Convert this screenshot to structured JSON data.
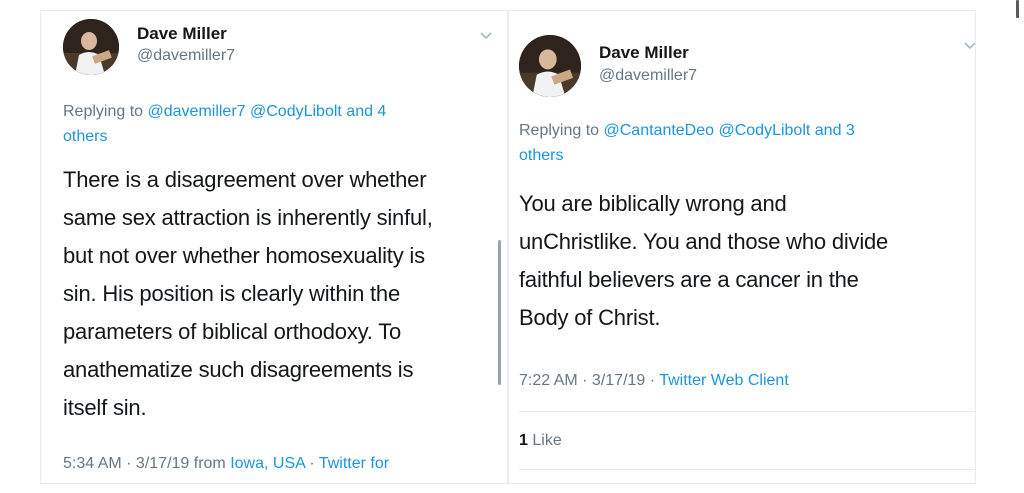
{
  "tweets": [
    {
      "author": {
        "name": "Dave Miller",
        "handle": "@davemiller7"
      },
      "replying": {
        "prefix": "Replying to",
        "links": "@davemiller7 @CodyLibolt and 4",
        "links2": "others"
      },
      "body_lines": [
        "There is a disagreement over whether",
        "same sex attraction is inherently sinful,",
        "but not over whether homosexuality is",
        "sin. His position is clearly within the",
        "parameters of biblical orthodoxy. To",
        "anathematize such disagreements is",
        "itself sin."
      ],
      "meta": {
        "time_date": "5:34 AM · 3/17/19 from",
        "location": "Iowa, USA",
        "sep": "·",
        "client": "Twitter for"
      }
    },
    {
      "author": {
        "name": "Dave Miller",
        "handle": "@davemiller7"
      },
      "replying": {
        "prefix": "Replying to",
        "links": "@CantanteDeo @CodyLibolt and 3",
        "links2": "others"
      },
      "body_lines": [
        "You are biblically wrong and",
        "unChristlike. You and those who divide",
        "faithful believers are a cancer in the",
        "Body of Christ."
      ],
      "meta": {
        "time_date": "7:22 AM · 3/17/19 ·",
        "client": "Twitter Web Client"
      },
      "likes": {
        "count": "1",
        "label": "Like"
      }
    }
  ],
  "icons": {
    "menu": "chevron-down-icon",
    "avatar": "profile-photo"
  },
  "colors": {
    "link": "#1b95e0",
    "secondary": "#657786",
    "text": "#14171a",
    "border": "#e6ecf0"
  }
}
